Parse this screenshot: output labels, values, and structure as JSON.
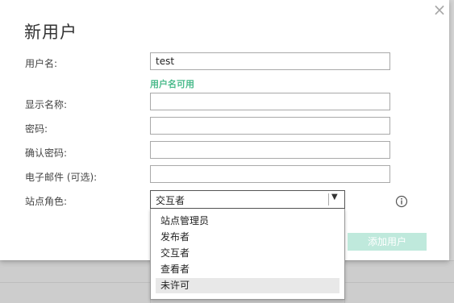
{
  "dialog": {
    "title": "新用户",
    "close_glyph": "×",
    "fields": {
      "username": {
        "label": "用户名:",
        "value": "test"
      },
      "username_hint": "用户名可用",
      "display_name": {
        "label": "显示名称:",
        "value": ""
      },
      "password": {
        "label": "密码:",
        "value": ""
      },
      "confirm_password": {
        "label": "确认密码:",
        "value": ""
      },
      "email": {
        "label": "电子邮件 (可选):",
        "value": ""
      },
      "site_role": {
        "label": "站点角色:",
        "selected": "交互者",
        "options": [
          "站点管理员",
          "发布者",
          "交互者",
          "查看者",
          "未许可"
        ],
        "highlighted": "未许可"
      }
    },
    "add_button_label": "添加用户",
    "info_icon": "info-icon"
  },
  "colors": {
    "hint": "#4bbb8c",
    "add_button_bg": "#bfe9dc",
    "backdrop": "#d4d4d4"
  }
}
